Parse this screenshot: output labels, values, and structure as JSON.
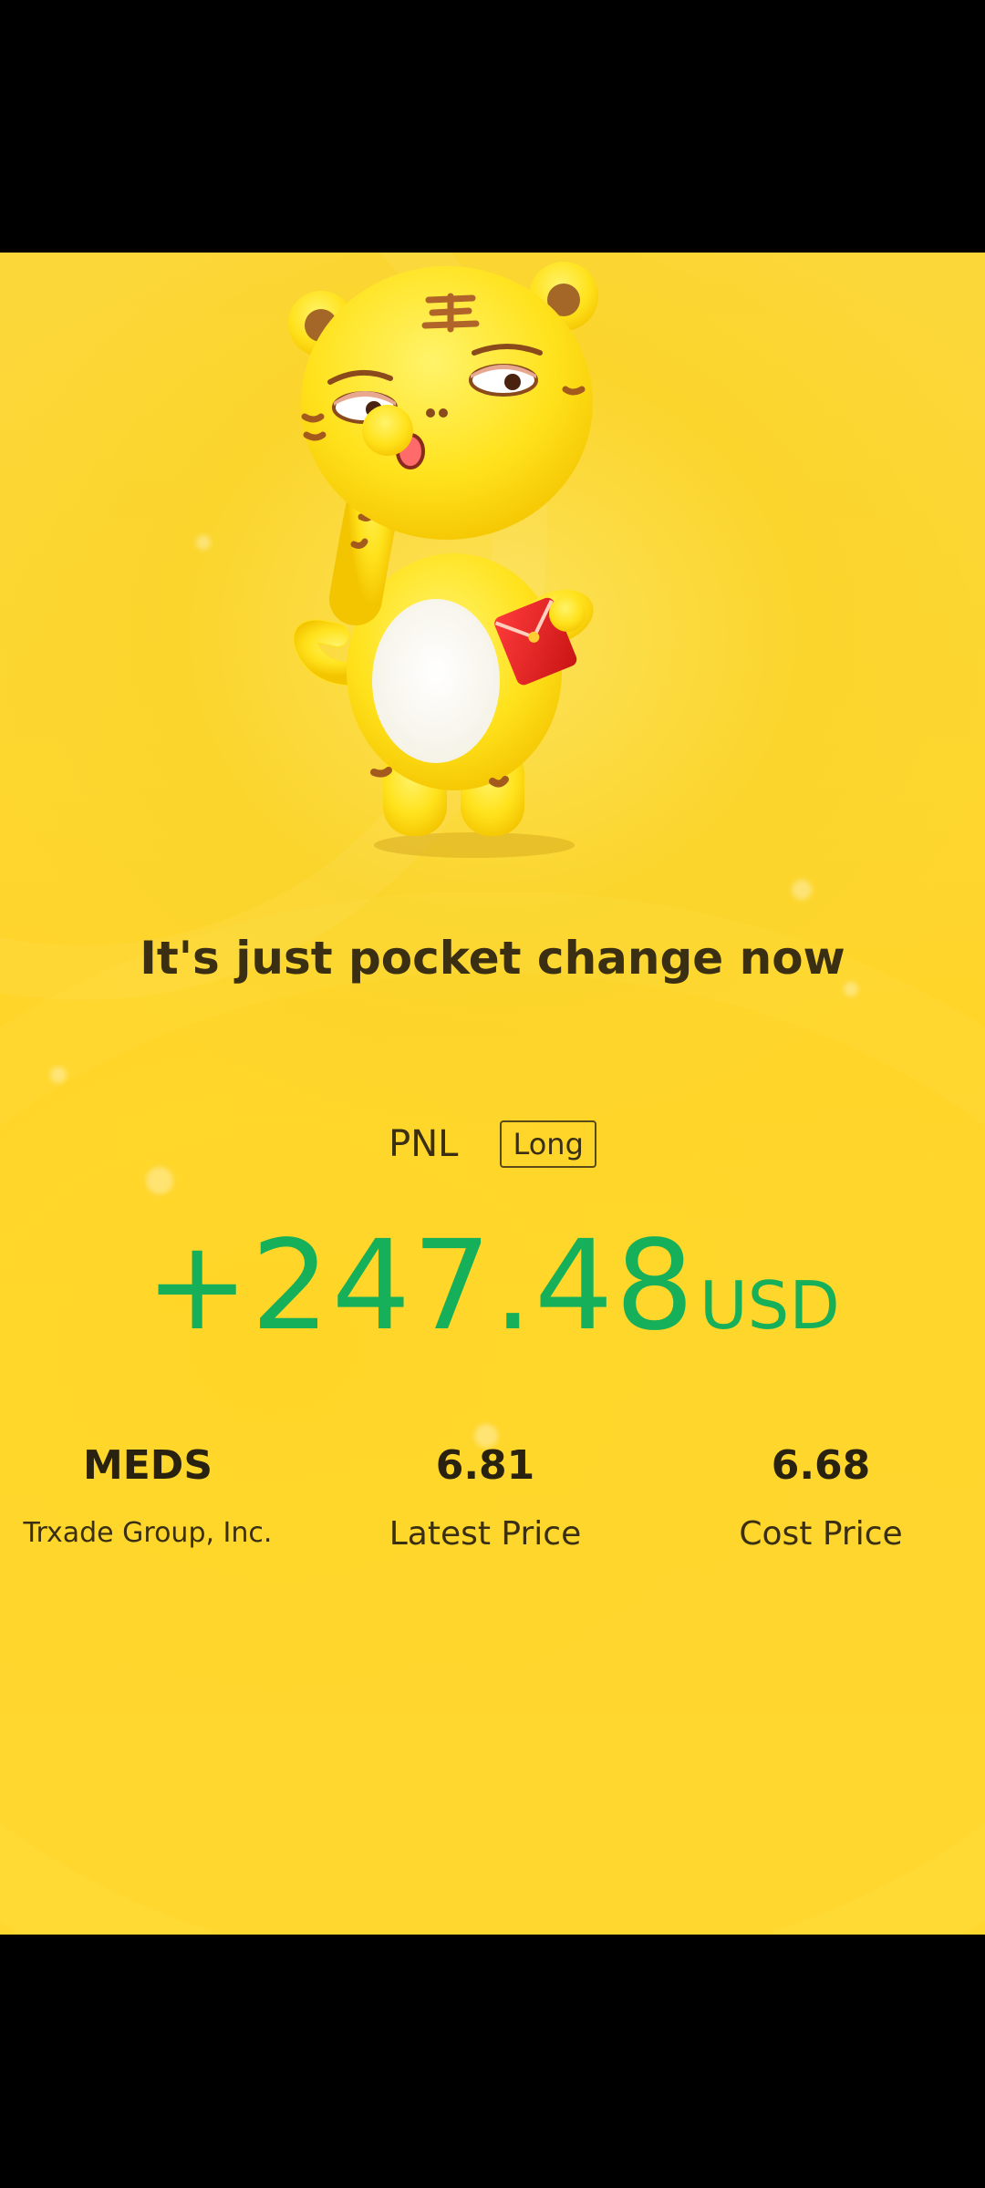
{
  "tagline": "It's just pocket change now",
  "pnl": {
    "label": "PNL",
    "direction_tag": "Long",
    "amount": "+247.48",
    "currency": "USD",
    "color": "#16b05a"
  },
  "stats": {
    "symbol": "MEDS",
    "company": "Trxade Group, Inc.",
    "latest_price": "6.81",
    "latest_price_label": "Latest Price",
    "cost_price": "6.68",
    "cost_price_label": "Cost Price"
  },
  "mascot": {
    "icon": "tiger-mascot-icon",
    "holding": "red-envelope-icon"
  },
  "colors": {
    "background": "#fbd52c",
    "text": "#3a2f12",
    "profit": "#16b05a"
  }
}
